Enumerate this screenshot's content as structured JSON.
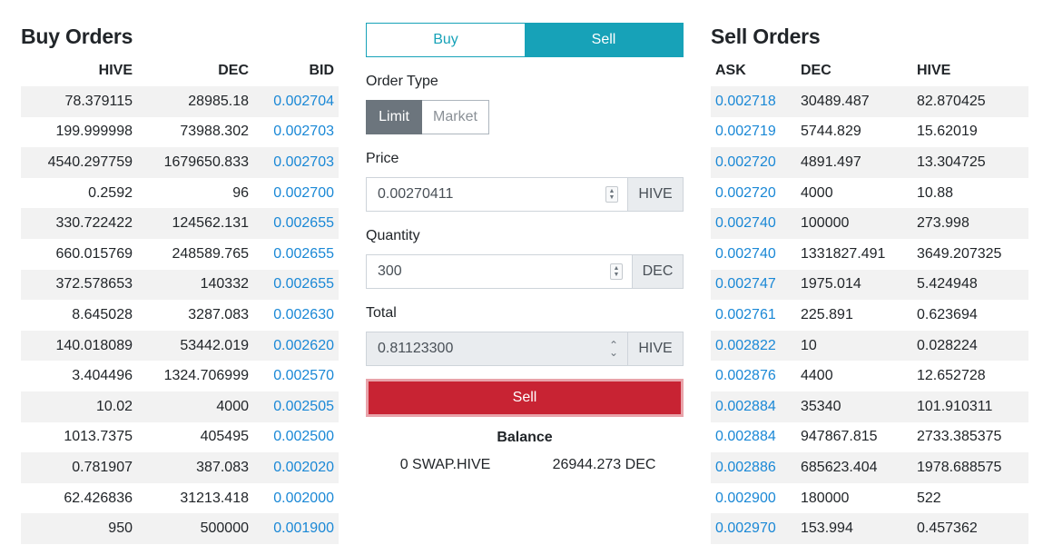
{
  "buy_orders": {
    "title": "Buy Orders",
    "headers": [
      "HIVE",
      "DEC",
      "BID"
    ],
    "rows": [
      [
        "78.379115",
        "28985.18",
        "0.002704"
      ],
      [
        "199.999998",
        "73988.302",
        "0.002703"
      ],
      [
        "4540.297759",
        "1679650.833",
        "0.002703"
      ],
      [
        "0.2592",
        "96",
        "0.002700"
      ],
      [
        "330.722422",
        "124562.131",
        "0.002655"
      ],
      [
        "660.015769",
        "248589.765",
        "0.002655"
      ],
      [
        "372.578653",
        "140332",
        "0.002655"
      ],
      [
        "8.645028",
        "3287.083",
        "0.002630"
      ],
      [
        "140.018089",
        "53442.019",
        "0.002620"
      ],
      [
        "3.404496",
        "1324.706999",
        "0.002570"
      ],
      [
        "10.02",
        "4000",
        "0.002505"
      ],
      [
        "1013.7375",
        "405495",
        "0.002500"
      ],
      [
        "0.781907",
        "387.083",
        "0.002020"
      ],
      [
        "62.426836",
        "31213.418",
        "0.002000"
      ],
      [
        "950",
        "500000",
        "0.001900"
      ]
    ]
  },
  "sell_orders": {
    "title": "Sell Orders",
    "headers": [
      "ASK",
      "DEC",
      "HIVE"
    ],
    "rows": [
      [
        "0.002718",
        "30489.487",
        "82.870425"
      ],
      [
        "0.002719",
        "5744.829",
        "15.62019"
      ],
      [
        "0.002720",
        "4891.497",
        "13.304725"
      ],
      [
        "0.002720",
        "4000",
        "10.88"
      ],
      [
        "0.002740",
        "100000",
        "273.998"
      ],
      [
        "0.002740",
        "1331827.491",
        "3649.207325"
      ],
      [
        "0.002747",
        "1975.014",
        "5.424948"
      ],
      [
        "0.002761",
        "225.891",
        "0.623694"
      ],
      [
        "0.002822",
        "10",
        "0.028224"
      ],
      [
        "0.002876",
        "4400",
        "12.652728"
      ],
      [
        "0.002884",
        "35340",
        "101.910311"
      ],
      [
        "0.002884",
        "947867.815",
        "2733.385375"
      ],
      [
        "0.002886",
        "685623.404",
        "1978.688575"
      ],
      [
        "0.002900",
        "180000",
        "522"
      ],
      [
        "0.002970",
        "153.994",
        "0.457362"
      ]
    ]
  },
  "form": {
    "side_buy": "Buy",
    "side_sell": "Sell",
    "active_side": "Sell",
    "order_type_label": "Order Type",
    "order_type_limit": "Limit",
    "order_type_market": "Market",
    "active_order_type": "Limit",
    "price_label": "Price",
    "price_value": "0.00270411",
    "price_unit": "HIVE",
    "quantity_label": "Quantity",
    "quantity_value": "300",
    "quantity_unit": "DEC",
    "total_label": "Total",
    "total_value": "0.81123300",
    "total_unit": "HIVE",
    "submit_label": "Sell",
    "balance_title": "Balance",
    "balance_hive": "0 SWAP.HIVE",
    "balance_dec": "26944.273 DEC"
  },
  "colors": {
    "accent": "#17a2b8",
    "sell_button": "#c82333",
    "link_price": "#1a88d6",
    "limit_active": "#6c757d"
  },
  "icons": [
    "spinner-icon"
  ]
}
